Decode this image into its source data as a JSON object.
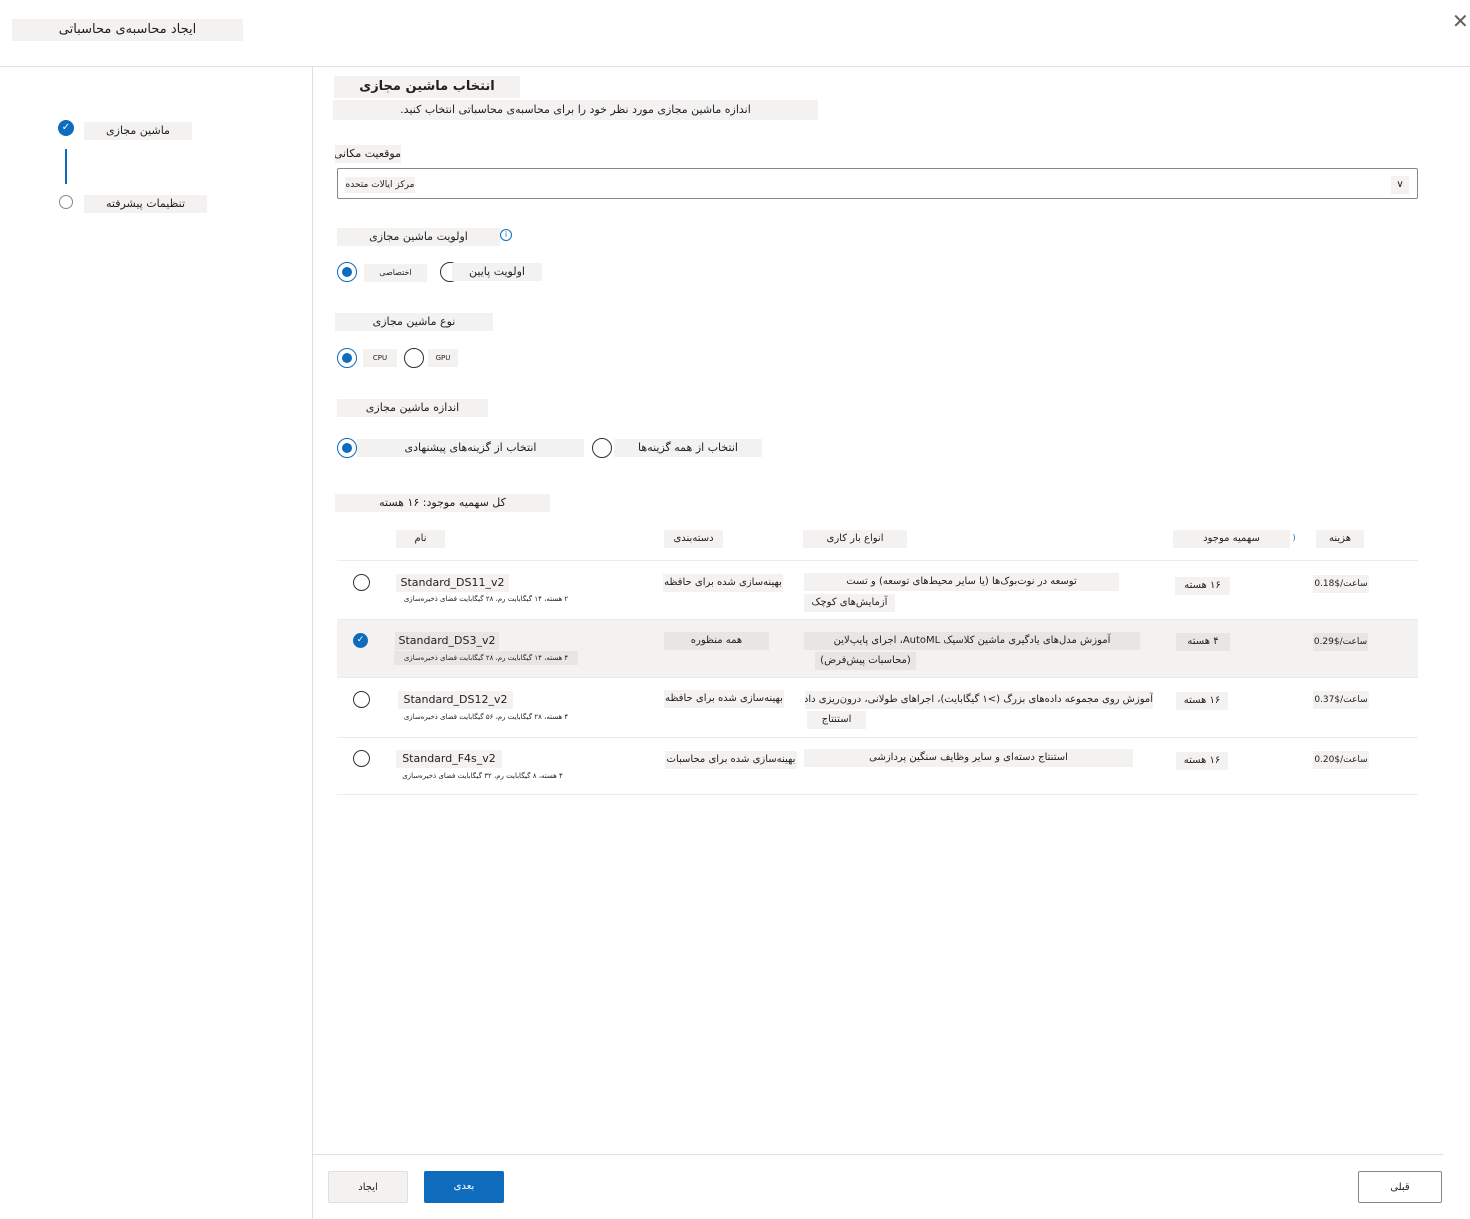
{
  "header": {
    "title": "ایجاد محاسبه‌ی محاسباتی",
    "close_icon": "close-icon"
  },
  "sidebar": {
    "steps": [
      {
        "label": "ماشین مجازی",
        "status": "done"
      },
      {
        "label": "تنظیمات پیشرفته",
        "status": "todo"
      }
    ]
  },
  "main": {
    "title": "انتخاب ماشین مجازی",
    "description": "اندازه ماشین مجازی مورد نظر خود را برای محاسبه‌ی محاسباتی انتخاب کنید.",
    "location": {
      "label": "موقعیت مکانی",
      "value": "مرکز ایالات متحده"
    },
    "priority": {
      "label": "اولویت ماشین مجازی",
      "options": [
        "اختصاصی",
        "اولویت پایین"
      ],
      "selected": 0
    },
    "vm_type": {
      "label": "نوع ماشین مجازی",
      "options": [
        "CPU",
        "GPU"
      ],
      "selected": 0
    },
    "vm_size": {
      "label": "اندازه ماشین مجازی",
      "options": [
        "انتخاب از گزینه‌های پیشنهادی",
        "انتخاب از همه گزینه‌ها"
      ],
      "selected": 0
    },
    "quota": {
      "label": "کل سهمیه موجود: ۱۶ هسته"
    },
    "table": {
      "headers": {
        "name": "نام",
        "category": "دسته‌بندی",
        "workload": "انواع بار کاری",
        "quota": "سهمیه موجود",
        "cost": "هزینه"
      },
      "rows": [
        {
          "name": "Standard_DS11_v2",
          "specs": "۲ هسته، ۱۴ گیگابایت رم، ۲۸ گیگابایت فضای ذخیره‌سازی",
          "category": "بهینه‌سازی شده برای حافظه",
          "workload": "توسعه در نوت‌بوک‌ها (یا سایر محیط‌های توسعه) و تست",
          "workload2": "آزمایش‌های کوچک",
          "quota": "۱۶ هسته",
          "cost": "0.18$/ساعت",
          "selected": false
        },
        {
          "name": "Standard_DS3_v2",
          "specs": "۴ هسته، ۱۴ گیگابایت رم، ۲۸ گیگابایت فضای ذخیره‌سازی",
          "category": "همه منظوره",
          "workload": "آموزش مدل‌های یادگیری ماشین کلاسیک AutoML، اجرای پایپ‌لاین",
          "workload2": "(محاسبات پیش‌فرض)",
          "quota": "۴ هسته",
          "cost": "0.29$/ساعت",
          "selected": true
        },
        {
          "name": "Standard_DS12_v2",
          "specs": "۴ هسته، ۲۸ گیگابایت رم، ۵۶ گیگابایت فضای ذخیره‌سازی",
          "category": "بهینه‌سازی شده برای حافظه",
          "workload": "آموزش روی مجموعه داده‌های بزرگ (>۱ گیگابایت)، اجراهای طولانی، درون‌ریزی داده",
          "workload2": "استنتاج",
          "quota": "۱۶ هسته",
          "cost": "0.37$/ساعت",
          "selected": false
        },
        {
          "name": "Standard_F4s_v2",
          "specs": "۴ هسته، ۸ گیگابایت رم، ۳۲ گیگابایت فضای ذخیره‌سازی",
          "category": "بهینه‌سازی شده برای محاسبات",
          "workload": "استنتاج دسته‌ای و سایر وظایف سنگین پردازشی",
          "workload2": "",
          "quota": "۱۶ هسته",
          "cost": "0.20$/ساعت",
          "selected": false
        }
      ]
    }
  },
  "footer": {
    "create": "ایجاد",
    "next": "بعدی",
    "back": "قبلی"
  },
  "colors": {
    "accent": "#0f6cbd",
    "chip": "#f3f2f1"
  }
}
